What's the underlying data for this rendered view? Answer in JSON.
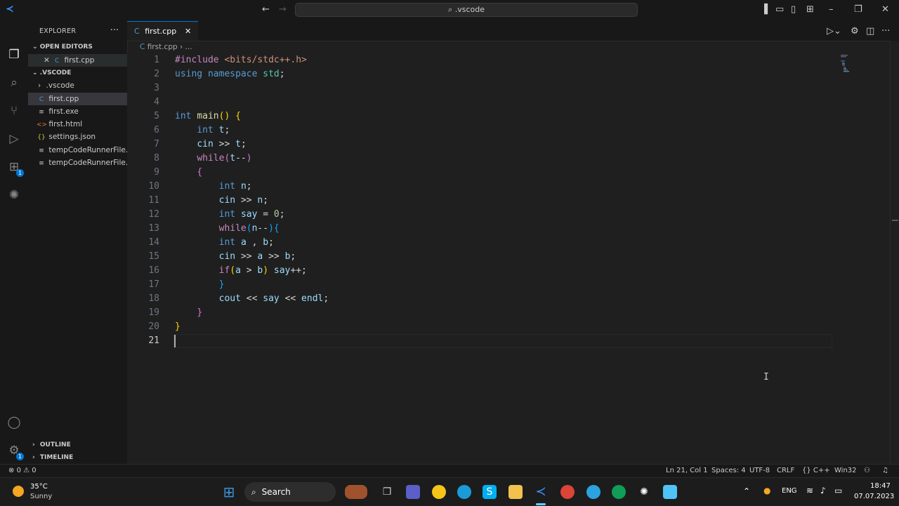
{
  "titlebar": {
    "search_text": ".vscode"
  },
  "explorer": {
    "title": "EXPLORER",
    "open_editors_label": "OPEN EDITORS",
    "open_editor_file": "first.cpp",
    "folder_label": ".VSCODE",
    "files": [
      {
        "name": ".vscode",
        "icon": "folder-chevron"
      },
      {
        "name": "first.cpp",
        "icon": "cpp-file-icon"
      },
      {
        "name": "first.exe",
        "icon": "exe-file-icon"
      },
      {
        "name": "first.html",
        "icon": "html-file-icon"
      },
      {
        "name": "settings.json",
        "icon": "json-file-icon"
      },
      {
        "name": "tempCodeRunnerFile....",
        "icon": "text-file-icon"
      },
      {
        "name": "tempCodeRunnerFile....",
        "icon": "text-file-icon"
      }
    ],
    "outline_label": "OUTLINE",
    "timeline_label": "TIMELINE"
  },
  "tab": {
    "label": "first.cpp"
  },
  "breadcrumb": {
    "file": "first.cpp",
    "rest": "..."
  },
  "code": {
    "lines": [
      "#include <bits/stdc++.h>",
      "using namespace std;",
      "",
      "",
      "int main() {",
      "    int t;",
      "    cin >> t;",
      "    while(t--)",
      "    {",
      "        int n;",
      "        cin >> n;",
      "        int say = 0;",
      "        while(n--){",
      "        int a , b;",
      "        cin >> a >> b;",
      "        if(a > b) say++;",
      "        }",
      "        cout << say << endl;",
      "    }",
      "}",
      ""
    ],
    "line_numbers": [
      "1",
      "2",
      "3",
      "4",
      "5",
      "6",
      "7",
      "8",
      "9",
      "10",
      "11",
      "12",
      "13",
      "14",
      "15",
      "16",
      "17",
      "18",
      "19",
      "20",
      "21"
    ]
  },
  "statusbar": {
    "errors": "0",
    "warnings": "0",
    "position": "Ln 21, Col 1",
    "spaces": "Spaces: 4",
    "encoding": "UTF-8",
    "eol": "CRLF",
    "language": "C++",
    "config": "Win32"
  },
  "taskbar": {
    "weather_temp": "35°C",
    "weather_desc": "Sunny",
    "search_label": "Search",
    "language": "ENG",
    "time": "18:47",
    "date": "07.07.2023"
  },
  "colors": {
    "accent": "#0078d4",
    "background": "#1f1f1f",
    "sidebar": "#181818"
  }
}
